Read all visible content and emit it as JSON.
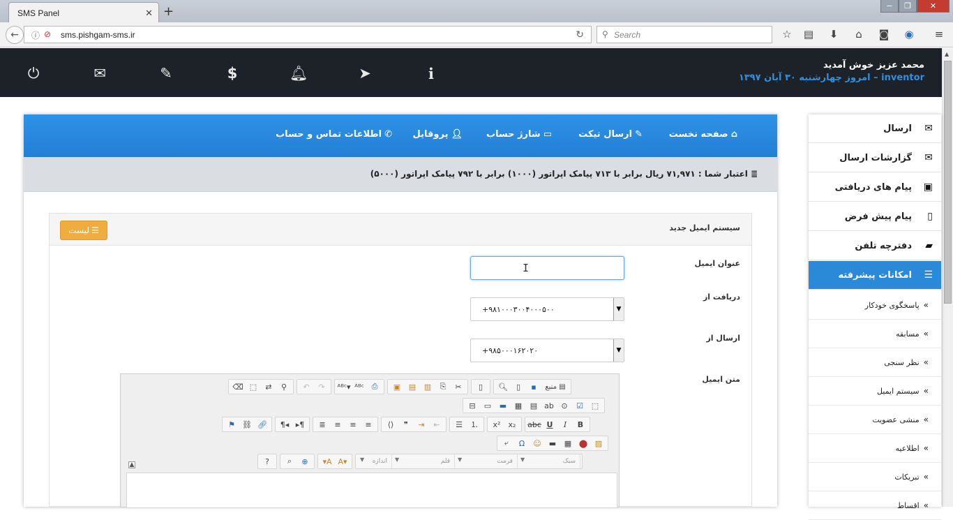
{
  "browser": {
    "tab_title": "SMS Panel",
    "tab_close": "✕",
    "new_tab": "+",
    "url": "sms.pishgam-sms.ir",
    "search_placeholder": "Search",
    "window_buttons": [
      "−",
      "❐",
      "✕"
    ]
  },
  "header": {
    "welcome_line": "محمد عزیز خوش آمدید",
    "info_line": "inventor – امروز چهارشنبه ۳۰ آبان ۱۳۹۷",
    "icons": [
      "power-icon",
      "mail-icon",
      "ticket-icon",
      "dollar-icon",
      "bell-icon",
      "send-icon",
      "info-icon"
    ]
  },
  "sidebar": {
    "items": [
      {
        "label": "ارسال",
        "icon": "envelope-icon"
      },
      {
        "label": "گزارشات ارسال",
        "icon": "envelope-outline-icon"
      },
      {
        "label": "پیام های دریافتی",
        "icon": "inbox-icon"
      },
      {
        "label": "پیام پیش فرض",
        "icon": "file-icon"
      },
      {
        "label": "دفترچه تلفن",
        "icon": "book-icon"
      },
      {
        "label": "امکانات پیشرفته",
        "icon": "list-icon",
        "active": true
      }
    ],
    "subitems": [
      "پاسخگوی خودکار",
      "مسابقه",
      "نظر سنجی",
      "سیستم ایمیل",
      "منشی عضویت",
      "اطلاعیه",
      "تبریکات",
      "اقساط"
    ]
  },
  "topnav": {
    "home": "صفحه نخست",
    "ticket": "ارسال تیکت",
    "charge": "شارژ حساب",
    "profile": "پروفایل",
    "contact": "اطلاعات تماس و حساب"
  },
  "credit": {
    "text": "اعتبار شما : ۷۱,۹۷۱ ریال برابر با ۷۱۳ پیامک اپراتور (۱۰۰۰) برابر با ۷۹۲ پیامک اپراتور (۵۰۰۰)"
  },
  "form": {
    "title": "سیستم ایمیل جدید",
    "list_button": "لیست",
    "email_title_label": "عنوان ایمیل",
    "email_title_value": "",
    "receive_from_label": "دریافت از",
    "receive_from_value": "+۹۸۱۰۰۰۳۰۰۴۰۰۰۵۰۰",
    "send_from_label": "ارسال از",
    "send_from_value": "+۹۸۵۰۰۰۱۶۲۰۲۰",
    "email_text_label": "متن ایمیل"
  },
  "editor": {
    "source_label": "منبع",
    "style_placeholder": "سبک",
    "format_placeholder": "فرمت",
    "font_placeholder": "قلم",
    "size_placeholder": "اندازه"
  },
  "colors": {
    "header_bg": "#1c2227",
    "accent_blue": "#2a8ad8",
    "list_button": "#f0ad3f",
    "credit_bar": "#dadde2"
  }
}
